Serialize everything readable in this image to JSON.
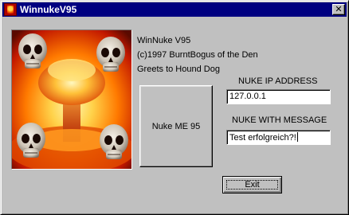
{
  "window": {
    "title": "WinnukeV95",
    "close_glyph": "✕"
  },
  "about": {
    "line1": "WinNuke V95",
    "line2": "(c)1997 BurntBogus of the Den",
    "line3": "Greets to Hound Dog"
  },
  "picture": {
    "description_icon": "skulls-mushroom-cloud-icon"
  },
  "nuke_button": {
    "label": "Nuke ME 95"
  },
  "ip_field": {
    "label": "NUKE IP ADDRESS",
    "value": "127.0.0.1"
  },
  "message_field": {
    "label": "NUKE WITH MESSAGE",
    "value": "Test erfolgreich?!"
  },
  "exit_button": {
    "label": "Exit"
  },
  "colors": {
    "titlebar": "#000080",
    "face": "#c0c0c0",
    "fire_orange": "#ff6a00",
    "fire_yellow": "#ffd24a"
  }
}
